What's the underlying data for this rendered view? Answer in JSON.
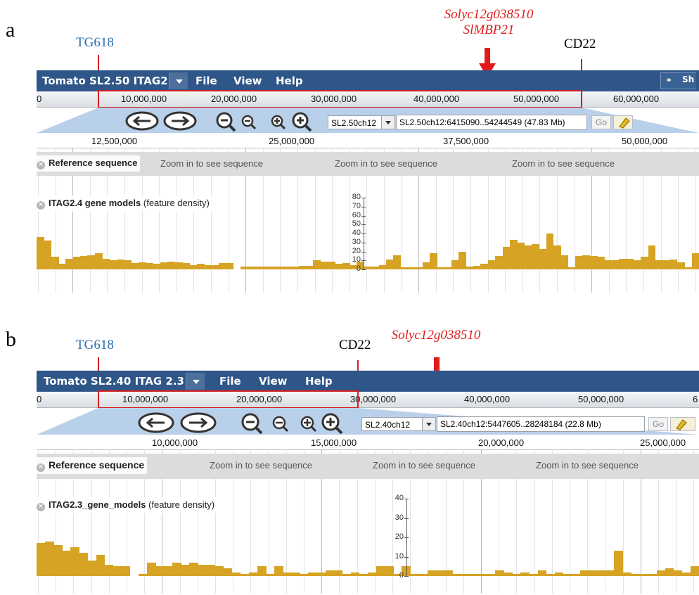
{
  "panels": [
    {
      "letter": "a",
      "annotations": {
        "left_marker": "TG618",
        "right_marker": "CD22",
        "gene_lines": [
          "Solyc12g038510",
          "SlMBP21"
        ]
      },
      "menubar": {
        "title": "Tomato SL2.50 ITAG2.4",
        "menus": [
          "File",
          "View",
          "Help"
        ],
        "share_partial": "Sh"
      },
      "overview_ruler": {
        "ticks": [
          "0",
          "10,000,000",
          "20,000,000",
          "30,000,000",
          "40,000,000",
          "50,000,000",
          "60,000,000"
        ]
      },
      "navigation": {
        "chromosome": "SL2.50ch12",
        "location": "SL2.50ch12:6415090..54244549 (47.83 Mb)",
        "go_label": "Go"
      },
      "detail_scale": {
        "ticks": [
          "12,500,000",
          "25,000,000",
          "37,500,000",
          "50,000,000"
        ]
      },
      "reference_track": {
        "label": "Reference sequence",
        "ghost": "sequence",
        "messages": [
          "Zoom in to see sequence",
          "Zoom in to see sequence",
          "Zoom in to see sequence"
        ]
      },
      "gene_track": {
        "label_bold": "ITAG2.4 gene models",
        "label_extra": "(feature density)",
        "y_ticks": [
          "80",
          "70",
          "60",
          "50",
          "40",
          "30",
          "20",
          "10",
          "0"
        ]
      },
      "chart_data": {
        "type": "bar",
        "series": [
          {
            "values": [
              36,
              32,
              14,
              6,
              12,
              14,
              15,
              16,
              18,
              12,
              10,
              11,
              10,
              7,
              8,
              7,
              6,
              8,
              9,
              8,
              7,
              5,
              6,
              5,
              5,
              7,
              7,
              0,
              3,
              3,
              3,
              3,
              3,
              3,
              3,
              3,
              4,
              4,
              10,
              9,
              9,
              6,
              7,
              5,
              9,
              3,
              3,
              5,
              11,
              16,
              2,
              2,
              2,
              8,
              18,
              2,
              2,
              10,
              20,
              3,
              4,
              6,
              10,
              15,
              25,
              33,
              30,
              27,
              28,
              23,
              40,
              27,
              16,
              2,
              15,
              16,
              15,
              14,
              10,
              10,
              12,
              12,
              10,
              14,
              27,
              10,
              10,
              11,
              8,
              2,
              18
            ]
          }
        ],
        "ylim": [
          0,
          80
        ]
      }
    },
    {
      "letter": "b",
      "annotations": {
        "left_marker": "TG618",
        "right_marker": "CD22",
        "gene_lines": [
          "Solyc12g038510"
        ]
      },
      "menubar": {
        "title": "Tomato SL2.40 ITAG 2.3",
        "menus": [
          "File",
          "View",
          "Help"
        ],
        "share_partial": ""
      },
      "overview_ruler": {
        "ticks": [
          "0",
          "10,000,000",
          "20,000,000",
          "30,000,000",
          "40,000,000",
          "50,000,000",
          "6"
        ]
      },
      "navigation": {
        "chromosome": "SL2.40ch12",
        "location": "SL2.40ch12:5447605..28248184 (22.8 Mb)",
        "go_label": "Go"
      },
      "detail_scale": {
        "ticks": [
          "10,000,000",
          "15,000,000",
          "20,000,000",
          "25,000,000"
        ]
      },
      "reference_track": {
        "label": "Reference sequence",
        "ghost": "e",
        "messages": [
          "Zoom in to see sequence",
          "Zoom in to see sequence",
          "Zoom in to see sequence"
        ]
      },
      "gene_track": {
        "label_bold": "ITAG2.3_gene_models",
        "label_extra": "(feature density)",
        "y_ticks": [
          "40",
          "30",
          "20",
          "10",
          "0"
        ]
      },
      "chart_data": {
        "type": "bar",
        "series": [
          {
            "values": [
              17,
              18,
              16,
              13,
              15,
              12,
              8,
              11,
              6,
              5,
              5,
              0,
              1,
              7,
              5,
              5,
              7,
              6,
              7,
              6,
              6,
              5,
              4,
              2,
              1,
              2,
              5,
              1,
              5,
              2,
              2,
              1,
              2,
              2,
              3,
              3,
              1,
              2,
              1,
              2,
              5,
              5,
              1,
              5,
              1,
              1,
              3,
              3,
              3,
              1,
              1,
              1,
              1,
              1,
              3,
              2,
              1,
              2,
              1,
              3,
              1,
              2,
              1,
              1,
              3,
              3,
              3,
              3,
              13,
              2,
              1,
              1,
              1,
              3,
              4,
              3,
              2,
              5
            ]
          }
        ],
        "ylim": [
          0,
          40
        ]
      }
    }
  ],
  "colors": {
    "menubar": "#2f5688",
    "highlight_box": "#d61e1e",
    "density_bar": "#d6a325",
    "marker_blue": "#2a6db3",
    "gene_red": "#e11b1b"
  }
}
